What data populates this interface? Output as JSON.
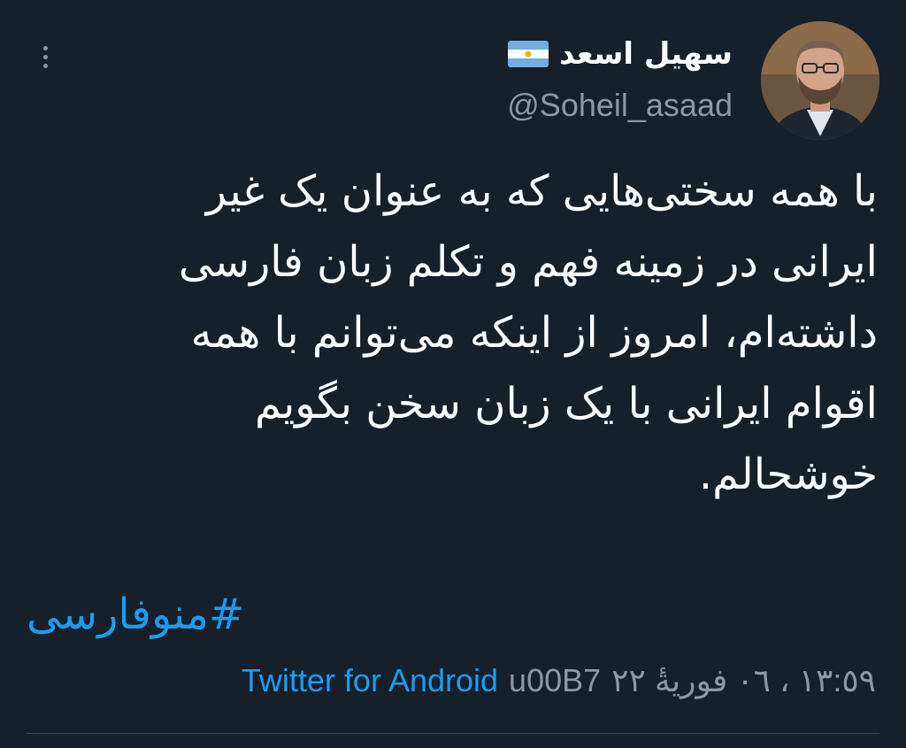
{
  "tweet": {
    "display_name": "سهیل اسعد",
    "flag_icon": "argentina-flag-icon",
    "handle": "@Soheil_asaad",
    "text": "با همه سختی‌هایی که به عنوان یک غیر\nایرانی در زمینه فهم و تکلم زبان فارسی\nداشته‌ام، امروز از اینکه می‌توانم با همه\nاقوام ایرانی با یک زبان سخن بگویم\nخوشحالم.",
    "hashtag": "#منوفارسی",
    "timestamp": "١٣:٥٩ ، ٠٦ فوريةٔ ٢٢",
    "separator": "u00B7",
    "source": "Twitter for Android"
  },
  "colors": {
    "background": "#15202b",
    "text": "#ffffff",
    "muted": "#8b98a5",
    "accent": "#1d9bf0",
    "divider": "#38444d"
  },
  "icons": {
    "more": "more-vertical-icon"
  }
}
